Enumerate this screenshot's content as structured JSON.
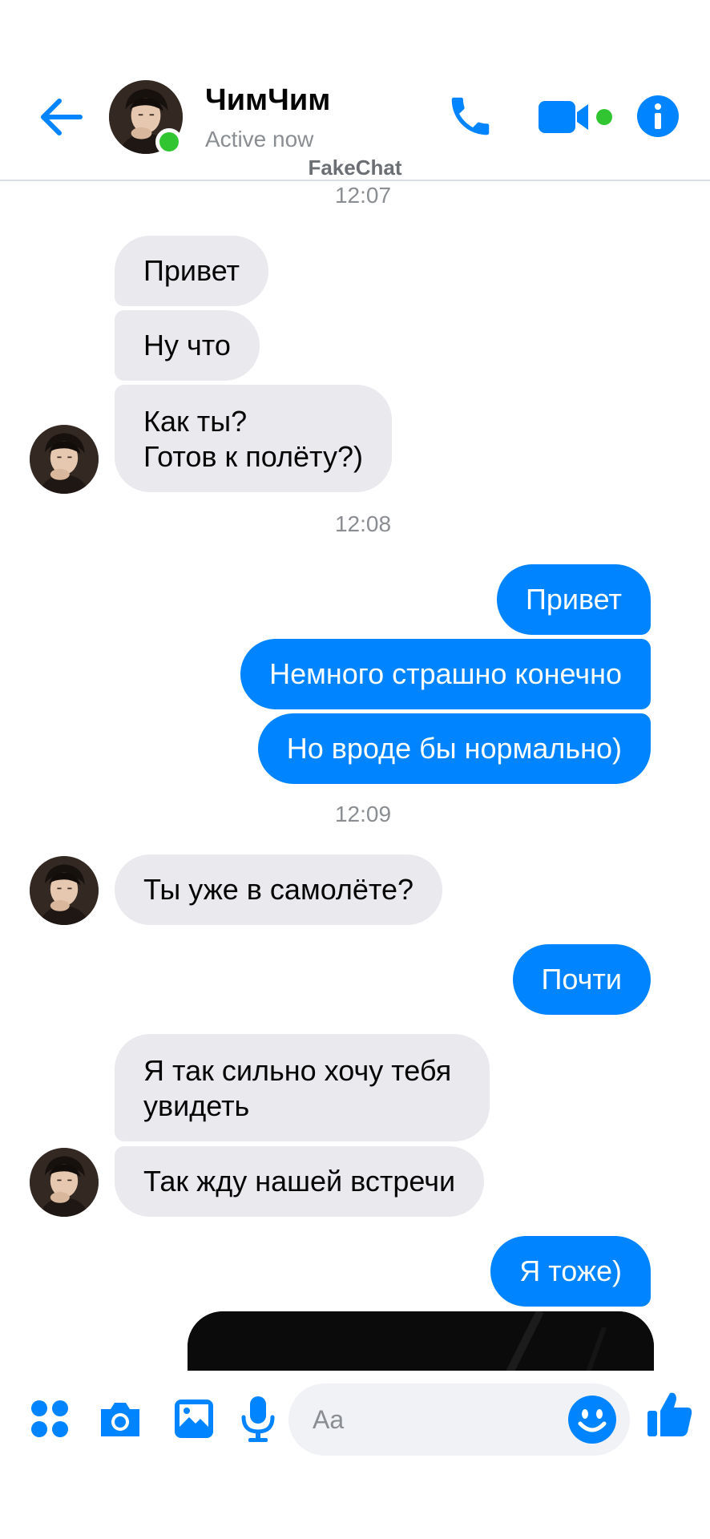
{
  "header": {
    "back_icon": "arrow-left-icon",
    "contact_name": "ЧимЧим",
    "status": "Active now",
    "watermark": "FakeChat",
    "call_icon": "phone-icon",
    "video_icon": "video-camera-icon",
    "info_icon": "info-icon"
  },
  "messages": {
    "t1": "12:07",
    "m1": "Привет",
    "m2": "Ну что",
    "m3_line1": "Как ты?",
    "m3_line2": "Готов к полёту?)",
    "t2": "12:08",
    "m4": "Привет",
    "m5": "Немного страшно конечно",
    "m6": "Но вроде бы нормально)",
    "t3": "12:09",
    "m7": "Ты уже в самолёте?",
    "m8": "Почти",
    "m9_line1": "Я так сильно хочу тебя",
    "m9_line2": "увидеть",
    "m10": "Так жду нашей встречи",
    "m11": "Я тоже)"
  },
  "composer": {
    "placeholder": "Aa",
    "apps_icon": "four-dots-icon",
    "camera_icon": "camera-icon",
    "gallery_icon": "image-icon",
    "mic_icon": "microphone-icon",
    "emoji_icon": "smile-icon",
    "like_icon": "thumbs-up-icon"
  },
  "colors": {
    "accent": "#0084ff",
    "incoming_bubble": "#e9e9ee",
    "online": "#31c631"
  }
}
